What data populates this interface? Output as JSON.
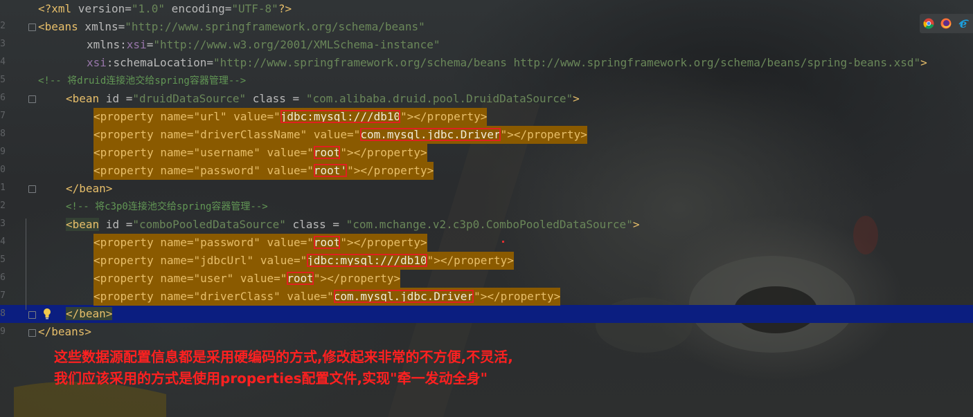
{
  "line_numbers": [
    "",
    "2",
    "3",
    "4",
    "5",
    "6",
    "7",
    "8",
    "9",
    "0",
    "1",
    "2",
    "3",
    "4",
    "5",
    "6",
    "7",
    "8",
    "9"
  ],
  "lines": {
    "l1": {
      "xml_decl_open": "<?xml",
      "version_attr": " version=",
      "version_val": "\"1.0\"",
      "enc_attr": " encoding=",
      "enc_val": "\"UTF-8\"",
      "close": "?>"
    },
    "l2": {
      "open": "<beans",
      "xmlns_attr": " xmlns=",
      "xmlns_val": "\"http://www.springframework.org/schema/beans\""
    },
    "l3": {
      "attr": "xmlns:",
      "ns": "xsi",
      "eq": "=",
      "val": "\"http://www.w3.org/2001/XMLSchema-instance\""
    },
    "l4": {
      "ns": "xsi",
      "attr": ":schemaLocation=",
      "val": "\"http://www.springframework.org/schema/beans http://www.springframework.org/schema/beans/spring-beans.xsd\"",
      "close": ">"
    },
    "l5": {
      "comment": "<!-- 将druid连接池交给spring容器管理-->"
    },
    "l6": {
      "open": "<bean",
      "id_attr": " id =",
      "id_val": "\"druidDataSource\"",
      "class_attr": " class = ",
      "class_val": "\"com.alibaba.druid.pool.DruidDataSource\"",
      "close": ">"
    },
    "l7": {
      "pre": "<property name=\"url\" value=\"",
      "boxed": "jdbc:mysql:///db10",
      "post": "\"></property>"
    },
    "l8": {
      "pre": "<property name=\"driverClassName\" value=\"",
      "boxed": "com.mysql.jdbc.Driver",
      "post": "\"></property>"
    },
    "l9": {
      "pre": "<property name=\"username\" value=\"",
      "boxed": "root",
      "post": "\"></property>"
    },
    "l10": {
      "pre": "<property name=\"password\" value=\"",
      "boxed": "root'",
      "post": "\"></property>"
    },
    "l11": {
      "close": "</bean>"
    },
    "l12": {
      "comment": "<!-- 将c3p0连接池交给spring容器管理-->"
    },
    "l13": {
      "open": "<bean",
      "id_attr": " id =",
      "id_val": "\"comboPooledDataSource\"",
      "class_attr": " class = ",
      "class_val": "\"com.mchange.v2.c3p0.ComboPooledDataSource\"",
      "close": ">"
    },
    "l14": {
      "pre": "<property name=\"password\" value=\"",
      "boxed": "root",
      "post": "\"></property>"
    },
    "l15": {
      "pre": "<property name=\"jdbcUrl\" value=\"",
      "boxed": "jdbc:mysql:///db10",
      "post": "\"></property>"
    },
    "l16": {
      "pre": "<property name=\"user\" value=\"",
      "boxed": "root",
      "post": "\"></property>"
    },
    "l17": {
      "pre": "<property name=\"driverClass\" value=\"",
      "boxed": "com.mysql.jdbc.Driver",
      "post": "\"></property>"
    },
    "l18": {
      "close": "</bean>"
    },
    "l19": {
      "close": "</beans>"
    }
  },
  "annotation": {
    "line1": "这些数据源配置信息都是采用硬编码的方式,修改起来非常的不方便,不灵活,",
    "line2": "我们应该采用的方式是使用properties配置文件,实现\"牵一发动全身\""
  },
  "browser_icons": [
    "chrome-icon",
    "firefox-icon",
    "ie-icon"
  ],
  "colors": {
    "current_line": "#0b1e80",
    "highlight": "#8a5a00",
    "annotation": "#ff2020",
    "tag": "#e8bf6a",
    "string": "#6a8759",
    "comment": "#629755"
  }
}
